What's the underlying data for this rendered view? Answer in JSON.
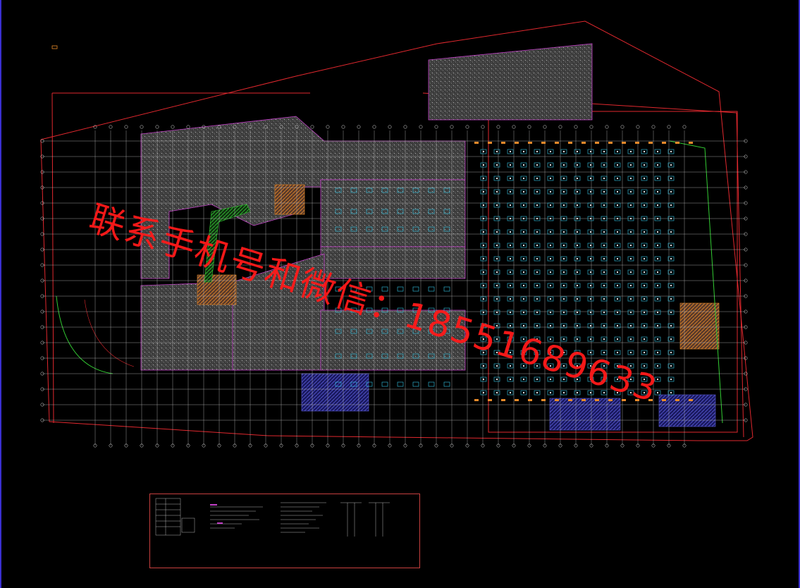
{
  "viewer": {
    "background": "#000000",
    "frame_left_color": "#3a2fd0",
    "frame_right_color": "#3a2fd0"
  },
  "drawing": {
    "boundary_color": "#e0282e",
    "grid_color": "#bfbfbf",
    "column_color": "#35c8e8",
    "hatch_color": "#8c8c8c",
    "outline_color": "#c23fc7",
    "green_color": "#33cc33",
    "orange_color": "#e88a2a",
    "blue_fill_color": "#3f3fbf"
  },
  "watermark": {
    "text": "联系手机号和微信：18551689633",
    "color": "#ff1a1a"
  },
  "legend": {
    "title_icon": "notes-table-icon",
    "border_color": "#c8403f"
  }
}
